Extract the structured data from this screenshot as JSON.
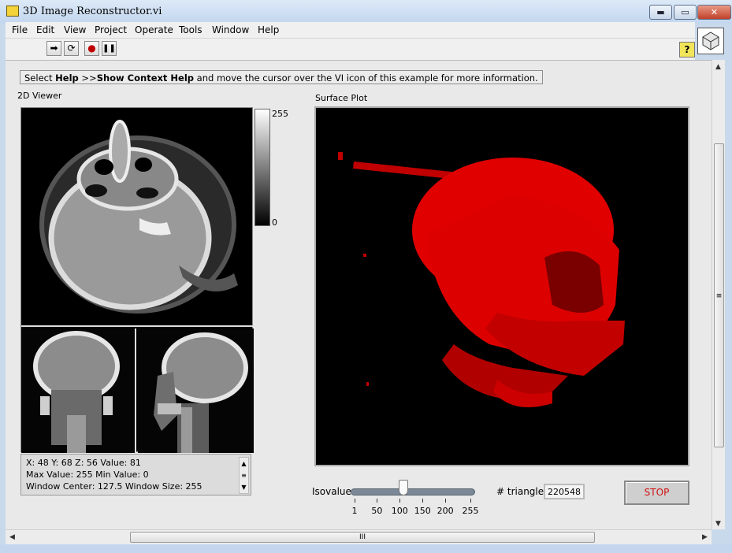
{
  "window": {
    "title": "3D Image Reconstructor.vi",
    "minimize": "▬",
    "maximize": "▭",
    "close": "✕"
  },
  "menu": [
    "File",
    "Edit",
    "View",
    "Project",
    "Operate",
    "Tools",
    "Window",
    "Help"
  ],
  "toolbar": {
    "run": "➡",
    "run_continuous": "⟳",
    "abort": "●",
    "pause": "❚❚",
    "help": "?"
  },
  "info_text": {
    "pre": "Select ",
    "help": "Help",
    "mid": " >>",
    "show": "Show Context Help",
    "post": " and move the cursor over the VI icon of this example for more information."
  },
  "viewer2d": {
    "label": "2D Viewer",
    "colorbar": {
      "max": "255",
      "min": "0"
    },
    "status": [
      "X: 48   Y: 68   Z: 56   Value: 81",
      "Max Value: 255    Min Value: 0",
      "Window Center: 127.5   Window Size: 255"
    ]
  },
  "surface": {
    "label": "Surface Plot"
  },
  "isovalue": {
    "label": "Isovalue",
    "value": 108,
    "min": 1,
    "max": 255,
    "ticks": [
      "1",
      "50",
      "100",
      "150",
      "200",
      "255"
    ]
  },
  "triangles": {
    "label": "# triangles",
    "value": "220548"
  },
  "stop_label": "STOP",
  "colors": {
    "skull": "#e00000",
    "stop_text": "#d01010"
  }
}
